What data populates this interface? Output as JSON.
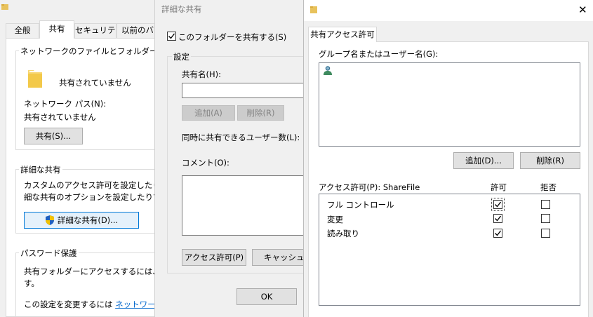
{
  "props": {
    "tabs": [
      "全般",
      "共有",
      "セキュリティ",
      "以前のバ"
    ],
    "network_section": {
      "title": "ネットワークのファイルとフォルダーの共有",
      "status": "共有されていません",
      "path_label": "ネットワーク パス(N):",
      "path_value": "共有されていません",
      "share_button": "共有(S)..."
    },
    "advanced_section": {
      "title": "詳細な共有",
      "desc1": "カスタムのアクセス許可を設定したり、複",
      "desc2": "細な共有のオプションを設定したりできま",
      "button": "詳細な共有(D)..."
    },
    "password_section": {
      "title": "パスワード保護",
      "desc1": "共有フォルダーにアクセスするには、ユーザ",
      "desc2": "す。",
      "change_text": "この設定を変更するには ",
      "change_link": "ネットワークと共"
    }
  },
  "advanced": {
    "title": "詳細な共有",
    "share_checkbox_label": "このフォルダーを共有する(S)",
    "settings_label": "設定",
    "share_name_label": "共有名(H):",
    "add_button": "追加(A)",
    "remove_button": "削除(R)",
    "users_limit_label": "同時に共有できるユーザー数(L):",
    "comment_label": "コメント(O):",
    "permissions_button": "アクセス許可(P)",
    "cancel_button": "キャッシュ(C",
    "ok_button": "OK"
  },
  "permissions": {
    "close_glyph": "✕",
    "tab": "共有アクセス許可",
    "group_label": "グループ名またはユーザー名(G):",
    "add_button": "追加(D)...",
    "remove_button": "削除(R)",
    "perm_label": "アクセス許可(P): ShareFile",
    "allow_header": "許可",
    "deny_header": "拒否",
    "rows": [
      {
        "name": "フル コントロール",
        "allow": true,
        "deny": false
      },
      {
        "name": "変更",
        "allow": true,
        "deny": false
      },
      {
        "name": "読み取り",
        "allow": true,
        "deny": false
      }
    ]
  }
}
